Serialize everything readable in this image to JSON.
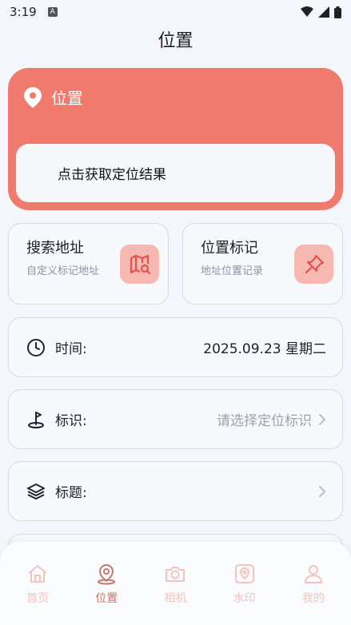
{
  "status": {
    "time": "3:19",
    "badge": "A"
  },
  "page": {
    "title": "位置"
  },
  "location": {
    "header": "位置",
    "result": "点击获取定位结果"
  },
  "features": [
    {
      "title": "搜索地址",
      "subtitle": "自定义标记地址",
      "icon": "map-search-icon"
    },
    {
      "title": "位置标记",
      "subtitle": "地址位置记录",
      "icon": "pin-icon"
    }
  ],
  "rows": {
    "time": {
      "label": "时间:",
      "value": "2025.09.23  星期二",
      "icon": "clock-icon"
    },
    "marker": {
      "label": "标识:",
      "placeholder": "请选择定位标识",
      "icon": "marker-icon"
    },
    "heading": {
      "label": "标题:",
      "icon": "layers-icon"
    }
  },
  "tabs": [
    {
      "label": "首页",
      "icon": "home-icon",
      "active": false
    },
    {
      "label": "位置",
      "icon": "location-icon",
      "active": true
    },
    {
      "label": "相机",
      "icon": "camera-icon",
      "active": false
    },
    {
      "label": "水印",
      "icon": "watermark-icon",
      "active": false
    },
    {
      "label": "我的",
      "icon": "user-icon",
      "active": false
    }
  ],
  "colors": {
    "accent": "#f07a6e",
    "accent_light": "#f8b8b2",
    "tab_active": "#c8776d",
    "tab_inactive": "#f3c3bd"
  }
}
